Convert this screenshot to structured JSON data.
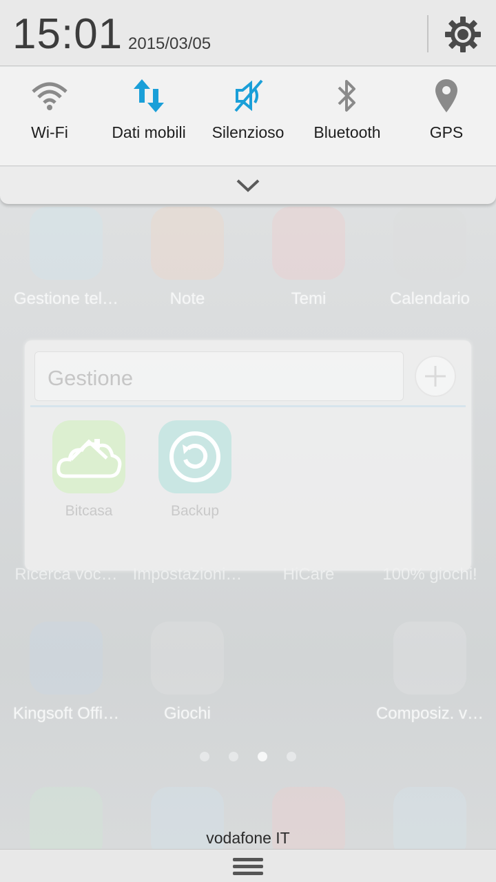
{
  "status": {
    "time": "15:01",
    "date": "2015/03/05",
    "settings_icon": "gear-icon"
  },
  "toggles": [
    {
      "label": "Wi-Fi",
      "icon": "wifi-icon",
      "active": false
    },
    {
      "label": "Dati mobili",
      "icon": "mobile-data-icon",
      "active": true
    },
    {
      "label": "Silenzioso",
      "icon": "silent-icon",
      "active": true
    },
    {
      "label": "Bluetooth",
      "icon": "bluetooth-icon",
      "active": false
    },
    {
      "label": "GPS",
      "icon": "gps-icon",
      "active": false
    }
  ],
  "expand_icon": "chevron-down-icon",
  "home": {
    "row1": [
      "Gestione tel…",
      "Note",
      "Temi",
      "Calendario"
    ],
    "row2": [
      "Ricerca voc…",
      "Impostazioni…",
      "HiCare",
      "100% giochi!"
    ],
    "row3": [
      "Kingsoft Offi…",
      "Giochi",
      "",
      "Composiz. v…"
    ]
  },
  "folder": {
    "name_placeholder": "Gestione",
    "apps": [
      {
        "label": "Bitcasa",
        "icon": "cloud-house-icon"
      },
      {
        "label": "Backup",
        "icon": "backup-icon"
      }
    ]
  },
  "carrier": "vodafone IT",
  "menu_icon": "menu-icon",
  "colors": {
    "accent": "#1a9fd8",
    "icon_gray": "#8a8a8a",
    "status_bg": "#e9e9e9"
  }
}
